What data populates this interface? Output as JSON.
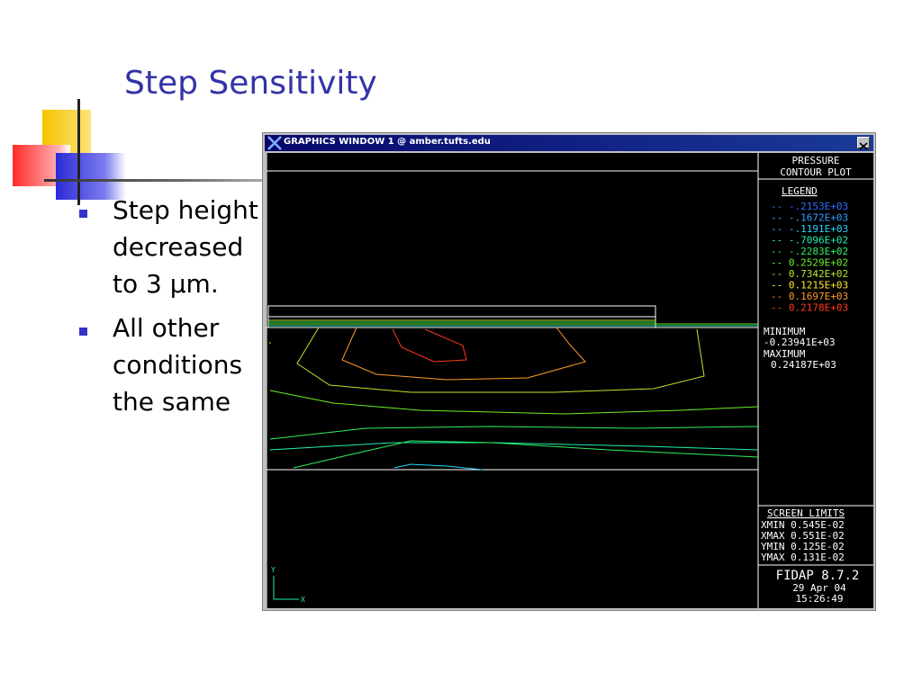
{
  "slide": {
    "title": "Step Sensitivity",
    "bullets": [
      "Step height decreased to 3 μm.",
      "All other conditions the same"
    ]
  },
  "window": {
    "title": "GRAPHICS WINDOW   1 @ amber.tufts.edu"
  },
  "plot_panel": {
    "header_line1": "PRESSURE",
    "header_line2": "CONTOUR PLOT",
    "legend_title": "LEGEND",
    "legend": [
      {
        "label": "-- -.2153E+03",
        "color": "#2f6cff"
      },
      {
        "label": "-- -.1672E+03",
        "color": "#2f9fff"
      },
      {
        "label": "-- -.1191E+03",
        "color": "#25d6ff"
      },
      {
        "label": "-- -.7096E+02",
        "color": "#21f0b0"
      },
      {
        "label": "-- -.2283E+02",
        "color": "#2df060"
      },
      {
        "label": "-- 0.2529E+02",
        "color": "#6cf02a"
      },
      {
        "label": "-- 0.7342E+02",
        "color": "#b8e82a"
      },
      {
        "label": "-- 0.1215E+03",
        "color": "#ffe830"
      },
      {
        "label": "-- 0.1697E+03",
        "color": "#ff9a2a"
      },
      {
        "label": "-- 0.2178E+03",
        "color": "#ff3a1a"
      }
    ],
    "minimum_label": "MINIMUM",
    "minimum_value": "-0.23941E+03",
    "maximum_label": "MAXIMUM",
    "maximum_value": "0.24187E+03",
    "screen_limits_title": "SCREEN LIMITS",
    "screen_limits": [
      "XMIN 0.545E-02",
      "XMAX 0.551E-02",
      "YMIN 0.125E-02",
      "YMAX 0.131E-02"
    ],
    "software": "FIDAP 8.7.2",
    "date": "29 Apr 04",
    "time": "15:26:49",
    "axis_y": "Y",
    "axis_x": "X"
  }
}
